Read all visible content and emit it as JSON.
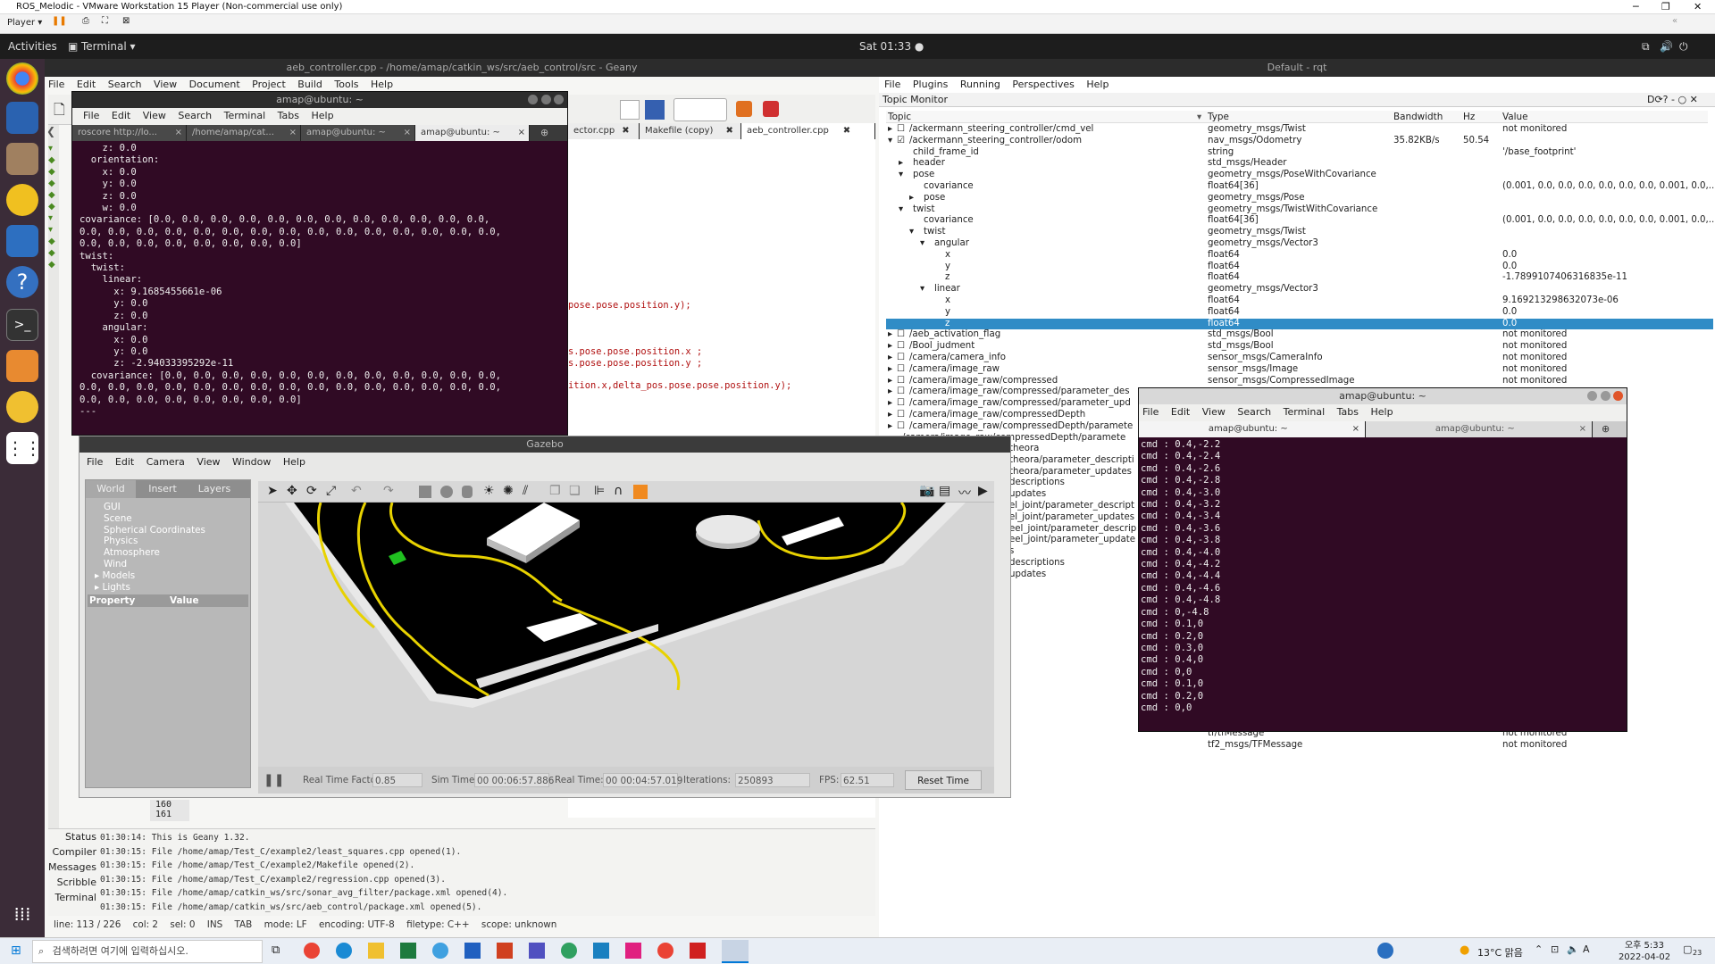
{
  "vm": {
    "title": "ROS_Melodic - VMware Workstation 15 Player (Non-commercial use only)",
    "player_label": "Player ▾"
  },
  "ubuntu": {
    "activities": "Activities",
    "app_menu": "Terminal ▾",
    "clock": "Sat 01:33 ●"
  },
  "geany": {
    "title": "aeb_controller.cpp - /home/amap/catkin_ws/src/aeb_control/src - Geany",
    "menu": [
      "File",
      "Edit",
      "Search",
      "View",
      "Document",
      "Project",
      "Build",
      "Tools",
      "Help"
    ],
    "tabs": [
      "ector.cpp",
      "Makefile (copy)",
      "aeb_controller.cpp"
    ],
    "code_lines": [
      "pose.pose.position.y);",
      "s.pose.pose.position.x ;",
      "s.pose.pose.position.y ;",
      "ition.x,delta_pos.pose.pose.position.y);"
    ],
    "line_numbers": [
      "160",
      "161"
    ],
    "msg_tabs": [
      "Status",
      "Compiler",
      "Messages",
      "Scribble",
      "Terminal"
    ],
    "messages": [
      "01:30:14: This is Geany 1.32.",
      "01:30:15: File /home/amap/Test_C/example2/least_squares.cpp opened(1).",
      "01:30:15: File /home/amap/Test_C/example2/Makefile opened(2).",
      "01:30:15: File /home/amap/Test_C/example2/regression.cpp opened(3).",
      "01:30:15: File /home/amap/catkin_ws/src/sonar_avg_filter/package.xml opened(4).",
      "01:30:15: File /home/amap/catkin_ws/src/aeb_control/package.xml opened(5)."
    ],
    "status": [
      "line: 113 / 226",
      "col: 2",
      "sel: 0",
      "INS",
      "TAB",
      "mode: LF",
      "encoding: UTF-8",
      "filetype: C++",
      "scope: unknown"
    ]
  },
  "terminal1": {
    "title": "amap@ubuntu: ~",
    "menu": [
      "File",
      "Edit",
      "View",
      "Search",
      "Terminal",
      "Tabs",
      "Help"
    ],
    "tabs": [
      "roscore http://lo...",
      "/home/amap/cat...",
      "amap@ubuntu: ~",
      "amap@ubuntu: ~"
    ],
    "output": "    z: 0.0\n  orientation:\n    x: 0.0\n    y: 0.0\n    z: 0.0\n    w: 0.0\ncovariance: [0.0, 0.0, 0.0, 0.0, 0.0, 0.0, 0.0, 0.0, 0.0, 0.0, 0.0, 0.0,\n0.0, 0.0, 0.0, 0.0, 0.0, 0.0, 0.0, 0.0, 0.0, 0.0, 0.0, 0.0, 0.0, 0.0, 0.0,\n0.0, 0.0, 0.0, 0.0, 0.0, 0.0, 0.0, 0.0]\ntwist:\n  twist:\n    linear:\n      x: 9.1685455661e-06\n      y: 0.0\n      z: 0.0\n    angular:\n      x: 0.0\n      y: 0.0\n      z: -2.94033395292e-11\n  covariance: [0.0, 0.0, 0.0, 0.0, 0.0, 0.0, 0.0, 0.0, 0.0, 0.0, 0.0, 0.0,\n0.0, 0.0, 0.0, 0.0, 0.0, 0.0, 0.0, 0.0, 0.0, 0.0, 0.0, 0.0, 0.0, 0.0, 0.0,\n0.0, 0.0, 0.0, 0.0, 0.0, 0.0, 0.0, 0.0]\n---"
  },
  "rqt": {
    "title": "Default - rqt",
    "menu": [
      "File",
      "Plugins",
      "Running",
      "Perspectives",
      "Help"
    ],
    "plugin_title": "Topic Monitor",
    "columns": [
      "Topic",
      "Type",
      "Bandwidth",
      "Hz",
      "Value"
    ],
    "rows": [
      {
        "indent": 0,
        "arrow": "▸",
        "check": "☐",
        "topic": "/ackermann_steering_controller/cmd_vel",
        "type": "geometry_msgs/Twist",
        "bw": "",
        "hz": "",
        "value": "not monitored"
      },
      {
        "indent": 0,
        "arrow": "▾",
        "check": "☑",
        "topic": "/ackermann_steering_controller/odom",
        "type": "nav_msgs/Odometry",
        "bw": "35.82KB/s",
        "hz": "50.54",
        "value": ""
      },
      {
        "indent": 1,
        "arrow": "",
        "check": "",
        "topic": "child_frame_id",
        "type": "string",
        "bw": "",
        "hz": "",
        "value": "'/base_footprint'"
      },
      {
        "indent": 1,
        "arrow": "▸",
        "check": "",
        "topic": "header",
        "type": "std_msgs/Header",
        "bw": "",
        "hz": "",
        "value": ""
      },
      {
        "indent": 1,
        "arrow": "▾",
        "check": "",
        "topic": "pose",
        "type": "geometry_msgs/PoseWithCovariance",
        "bw": "",
        "hz": "",
        "value": ""
      },
      {
        "indent": 2,
        "arrow": "",
        "check": "",
        "topic": "covariance",
        "type": "float64[36]",
        "bw": "",
        "hz": "",
        "value": "(0.001, 0.0, 0.0, 0.0, 0.0, 0.0, 0.0, 0.001, 0.0,..."
      },
      {
        "indent": 2,
        "arrow": "▸",
        "check": "",
        "topic": "pose",
        "type": "geometry_msgs/Pose",
        "bw": "",
        "hz": "",
        "value": ""
      },
      {
        "indent": 1,
        "arrow": "▾",
        "check": "",
        "topic": "twist",
        "type": "geometry_msgs/TwistWithCovariance",
        "bw": "",
        "hz": "",
        "value": ""
      },
      {
        "indent": 2,
        "arrow": "",
        "check": "",
        "topic": "covariance",
        "type": "float64[36]",
        "bw": "",
        "hz": "",
        "value": "(0.001, 0.0, 0.0, 0.0, 0.0, 0.0, 0.0, 0.001, 0.0,..."
      },
      {
        "indent": 2,
        "arrow": "▾",
        "check": "",
        "topic": "twist",
        "type": "geometry_msgs/Twist",
        "bw": "",
        "hz": "",
        "value": ""
      },
      {
        "indent": 3,
        "arrow": "▾",
        "check": "",
        "topic": "angular",
        "type": "geometry_msgs/Vector3",
        "bw": "",
        "hz": "",
        "value": ""
      },
      {
        "indent": 4,
        "arrow": "",
        "check": "",
        "topic": "x",
        "type": "float64",
        "bw": "",
        "hz": "",
        "value": "0.0"
      },
      {
        "indent": 4,
        "arrow": "",
        "check": "",
        "topic": "y",
        "type": "float64",
        "bw": "",
        "hz": "",
        "value": "0.0"
      },
      {
        "indent": 4,
        "arrow": "",
        "check": "",
        "topic": "z",
        "type": "float64",
        "bw": "",
        "hz": "",
        "value": "-1.7899107406316835e-11"
      },
      {
        "indent": 3,
        "arrow": "▾",
        "check": "",
        "topic": "linear",
        "type": "geometry_msgs/Vector3",
        "bw": "",
        "hz": "",
        "value": ""
      },
      {
        "indent": 4,
        "arrow": "",
        "check": "",
        "topic": "x",
        "type": "float64",
        "bw": "",
        "hz": "",
        "value": "9.169213298632073e-06"
      },
      {
        "indent": 4,
        "arrow": "",
        "check": "",
        "topic": "y",
        "type": "float64",
        "bw": "",
        "hz": "",
        "value": "0.0"
      },
      {
        "indent": 4,
        "arrow": "",
        "check": "",
        "topic": "z",
        "type": "float64",
        "bw": "",
        "hz": "",
        "value": "0.0",
        "selected": true
      },
      {
        "indent": 0,
        "arrow": "▸",
        "check": "☐",
        "topic": "/aeb_activation_flag",
        "type": "std_msgs/Bool",
        "bw": "",
        "hz": "",
        "value": "not monitored"
      },
      {
        "indent": 0,
        "arrow": "▸",
        "check": "☐",
        "topic": "/Bool_judment",
        "type": "std_msgs/Bool",
        "bw": "",
        "hz": "",
        "value": "not monitored"
      },
      {
        "indent": 0,
        "arrow": "▸",
        "check": "☐",
        "topic": "/camera/camera_info",
        "type": "sensor_msgs/CameraInfo",
        "bw": "",
        "hz": "",
        "value": "not monitored"
      },
      {
        "indent": 0,
        "arrow": "▸",
        "check": "☐",
        "topic": "/camera/image_raw",
        "type": "sensor_msgs/Image",
        "bw": "",
        "hz": "",
        "value": "not monitored"
      },
      {
        "indent": 0,
        "arrow": "▸",
        "check": "☐",
        "topic": "/camera/image_raw/compressed",
        "type": "sensor_msgs/CompressedImage",
        "bw": "",
        "hz": "",
        "value": "not monitored"
      },
      {
        "indent": 0,
        "arrow": "▸",
        "check": "☐",
        "topic": "/camera/image_raw/compressed/parameter_des",
        "type": "",
        "bw": "",
        "hz": "",
        "value": ""
      },
      {
        "indent": 0,
        "arrow": "▸",
        "check": "☐",
        "topic": "/camera/image_raw/compressed/parameter_upd",
        "type": "",
        "bw": "",
        "hz": "",
        "value": ""
      },
      {
        "indent": 0,
        "arrow": "▸",
        "check": "☐",
        "topic": "/camera/image_raw/compressedDepth",
        "type": "",
        "bw": "",
        "hz": "",
        "value": ""
      },
      {
        "indent": 0,
        "arrow": "▸",
        "check": "☐",
        "topic": "/camera/image_raw/compressedDepth/paramete",
        "type": "",
        "bw": "",
        "hz": "",
        "value": ""
      },
      {
        "indent": 0,
        "arrow": "",
        "check": "",
        "topic": "/camera/image_raw/compressedDepth/paramete",
        "type": "",
        "bw": "",
        "hz": "",
        "value": ""
      }
    ],
    "partial_rows": [
      "theora",
      "theora/parameter_descripti",
      "theora/parameter_updates",
      "descriptions",
      "updates",
      "el_joint/parameter_descript",
      "el_joint/parameter_updates",
      "eel_joint/parameter_descrip",
      "eel_joint/parameter_update",
      "s",
      "descriptions",
      "updates"
    ],
    "bottom_rows": [
      {
        "type": "tf/tfMessage",
        "value": "not monitored"
      },
      {
        "type": "tf2_msgs/TFMessage",
        "value": "not monitored"
      }
    ]
  },
  "terminal2": {
    "title": "amap@ubuntu: ~",
    "menu": [
      "File",
      "Edit",
      "View",
      "Search",
      "Terminal",
      "Tabs",
      "Help"
    ],
    "tabs": [
      "amap@ubuntu: ~",
      "amap@ubuntu: ~"
    ],
    "output": "cmd : 0.4,-2.2\ncmd : 0.4,-2.4\ncmd : 0.4,-2.6\ncmd : 0.4,-2.8\ncmd : 0.4,-3.0\ncmd : 0.4,-3.2\ncmd : 0.4,-3.4\ncmd : 0.4,-3.6\ncmd : 0.4,-3.8\ncmd : 0.4,-4.0\ncmd : 0.4,-4.2\ncmd : 0.4,-4.4\ncmd : 0.4,-4.6\ncmd : 0.4,-4.8\ncmd : 0,-4.8\ncmd : 0.1,0\ncmd : 0.2,0\ncmd : 0.3,0\ncmd : 0.4,0\ncmd : 0,0\ncmd : 0.1,0\ncmd : 0.2,0\ncmd : 0,0"
  },
  "gazebo": {
    "title": "Gazebo",
    "menu": [
      "File",
      "Edit",
      "Camera",
      "View",
      "Window",
      "Help"
    ],
    "panel_tabs": [
      "World",
      "Insert",
      "Layers"
    ],
    "world_items": [
      "GUI",
      "Scene",
      "Spherical Coordinates",
      "Physics",
      "Atmosphere",
      "Wind",
      "Models",
      "Lights"
    ],
    "prop_headers": [
      "Property",
      "Value"
    ],
    "rtf_label": "Real Time Factor:",
    "rtf_value": "0.85",
    "sim_label": "Sim Time:",
    "sim_value": "00 00:06:57.886",
    "real_label": "Real Time:",
    "real_value": "00 00:04:57.019",
    "iter_label": "Iterations:",
    "iter_value": "250893",
    "fps_label": "FPS:",
    "fps_value": "62.51",
    "reset_label": "Reset Time"
  },
  "taskbar": {
    "search_placeholder": "검색하려면 여기에 입력하십시오.",
    "weather": "13°C 맑음",
    "ime": "A",
    "time": "오후 5:33",
    "date": "2022-04-02",
    "notif": "23"
  }
}
